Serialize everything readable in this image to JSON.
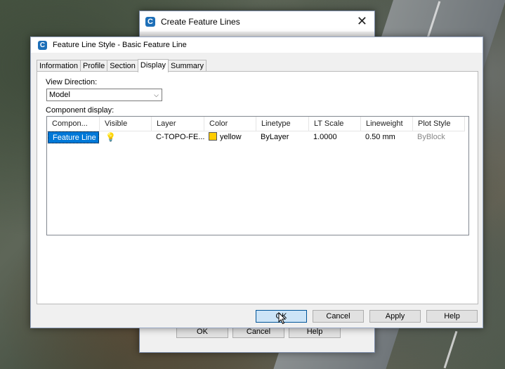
{
  "back_dialog": {
    "title": "Create Feature Lines",
    "ok_label": "OK",
    "cancel_label": "Cancel",
    "help_label": "Help"
  },
  "main_dialog": {
    "title": "Feature Line Style - Basic Feature Line",
    "app_icon_letter": "C",
    "tabs": [
      "Information",
      "Profile",
      "Section",
      "Display",
      "Summary"
    ],
    "active_tab": "Display",
    "view_direction_label": "View Direction:",
    "view_direction_value": "Model",
    "component_display_label": "Component display:",
    "columns": [
      "Compon...",
      "Visible",
      "Layer",
      "Color",
      "Linetype",
      "LT Scale",
      "Lineweight",
      "Plot Style"
    ],
    "row": {
      "component": "Feature Line",
      "visible_icon": "lightbulb-icon",
      "layer": "C-TOPO-FE...",
      "color": "yellow",
      "color_hex": "#ffcc00",
      "linetype": "ByLayer",
      "lt_scale": "1.0000",
      "lineweight": "0.50 mm",
      "plot_style": "ByBlock"
    },
    "buttons": {
      "ok": "OK",
      "cancel": "Cancel",
      "apply": "Apply",
      "help": "Help"
    }
  }
}
